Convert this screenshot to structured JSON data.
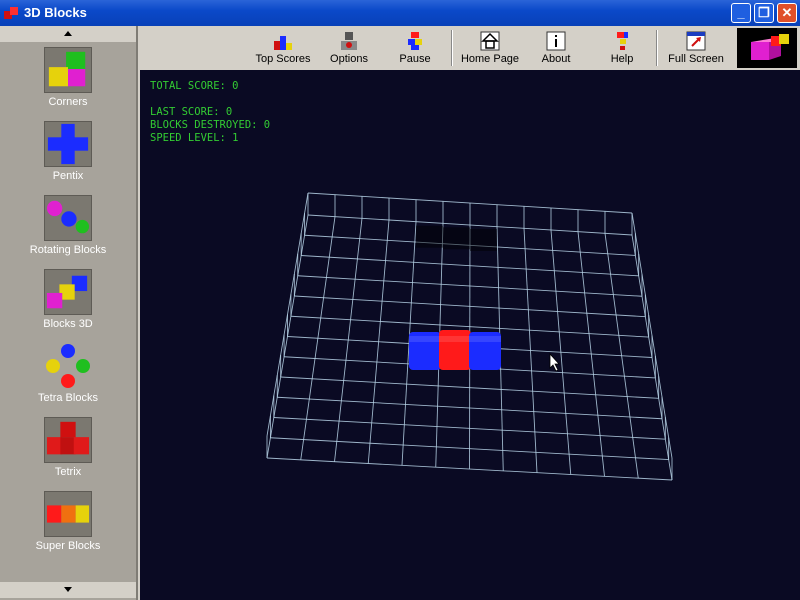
{
  "window": {
    "title": "3D Blocks"
  },
  "sidebar": {
    "items": [
      {
        "label": "Corners",
        "icon": "corners-icon"
      },
      {
        "label": "Pentix",
        "icon": "pentix-icon"
      },
      {
        "label": "Rotating Blocks",
        "icon": "rotating-blocks-icon"
      },
      {
        "label": "Blocks 3D",
        "icon": "blocks-3d-icon"
      },
      {
        "label": "Tetra Blocks",
        "icon": "tetra-blocks-icon"
      },
      {
        "label": "Tetrix",
        "icon": "tetrix-icon"
      },
      {
        "label": "Super Blocks",
        "icon": "super-blocks-icon"
      }
    ]
  },
  "toolbar": {
    "top_scores": "Top Scores",
    "options": "Options",
    "pause": "Pause",
    "home_page": "Home Page",
    "about": "About",
    "help": "Help",
    "full_screen": "Full Screen"
  },
  "stats": {
    "total_score": "TOTAL SCORE: 0",
    "last_score": "LAST SCORE: 0",
    "blocks_destroyed": "BLOCKS DESTROYED: 0",
    "speed_level": "SPEED LEVEL: 1"
  },
  "colors": {
    "background": "#0a0a23",
    "grid": "#b8d4e8",
    "stats_text": "#33cc33",
    "block_blue": "#1b2cff",
    "block_red": "#ff1a1a"
  }
}
